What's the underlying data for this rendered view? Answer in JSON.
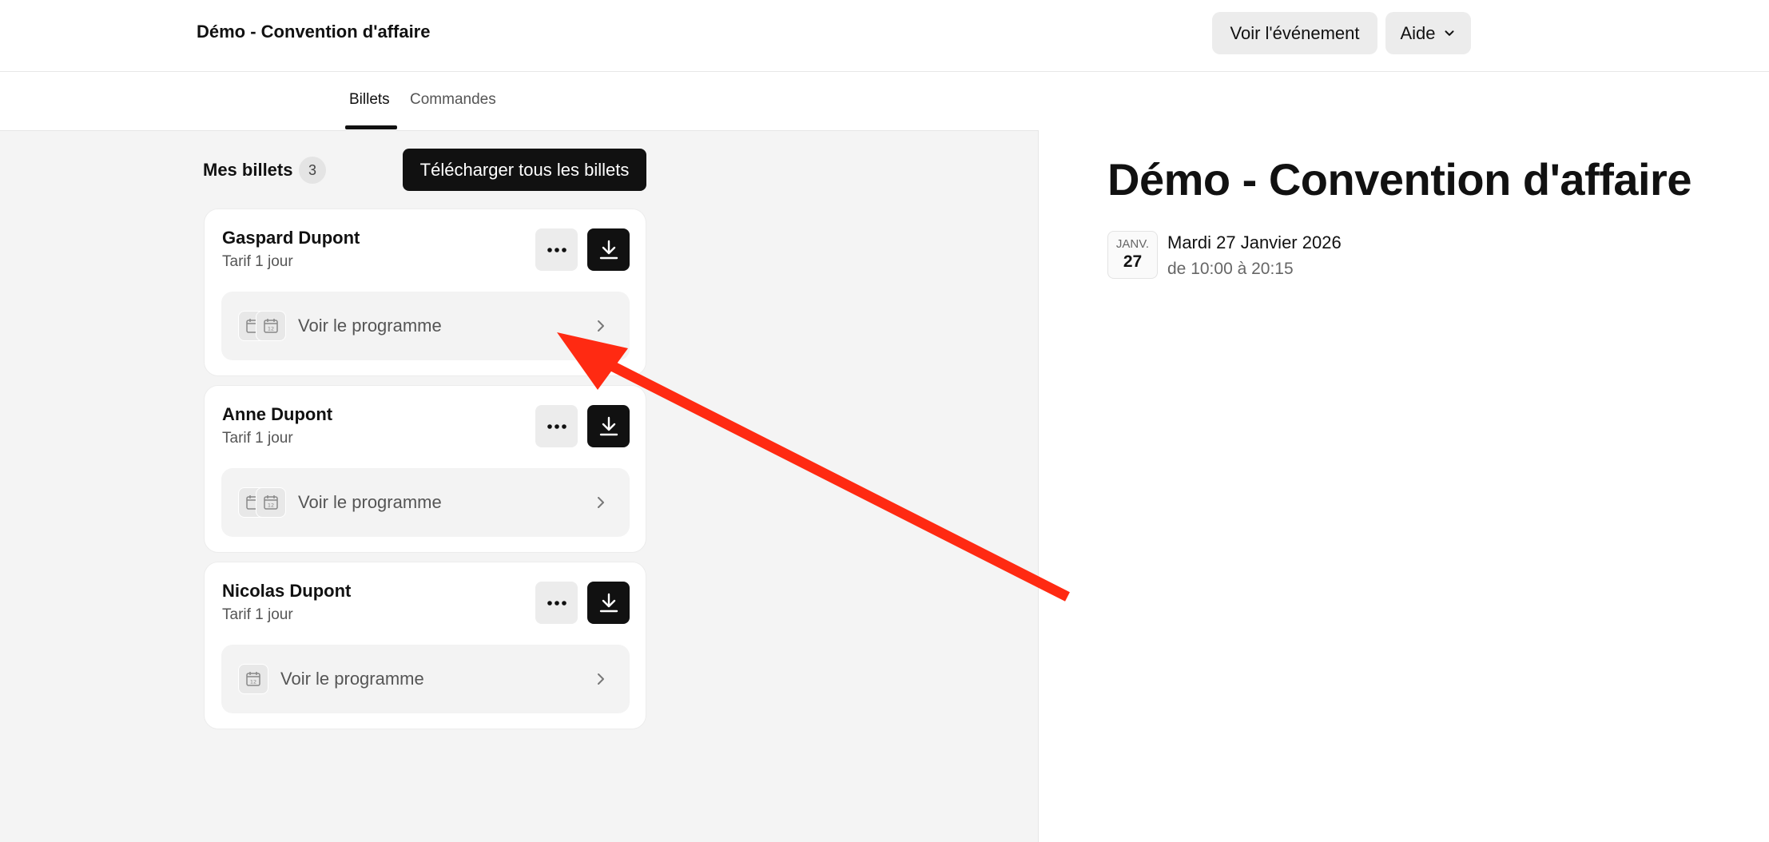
{
  "header": {
    "app_title": "Démo - Convention d'affaire",
    "view_event_label": "Voir l'événement",
    "help_label": "Aide"
  },
  "tabs": [
    {
      "label": "Billets",
      "active": true
    },
    {
      "label": "Commandes",
      "active": false
    }
  ],
  "tickets_section": {
    "title": "Mes billets",
    "count": "3",
    "download_all_label": "Télécharger tous les billets"
  },
  "tickets": [
    {
      "name": "Gaspard Dupont",
      "tier": "Tarif 1 jour",
      "program_label": "Voir le programme"
    },
    {
      "name": "Anne Dupont",
      "tier": "Tarif 1 jour",
      "program_label": "Voir le programme"
    },
    {
      "name": "Nicolas Dupont",
      "tier": "Tarif 1 jour",
      "program_label": "Voir le programme"
    }
  ],
  "event": {
    "title": "Démo - Convention d'affaire",
    "month": "JANV.",
    "day": "27",
    "date_text": "Mardi 27 Janvier 2026",
    "time_text": "de 10:00 à 20:15"
  },
  "icons": {
    "more": "more-horizontal-icon",
    "download": "download-icon",
    "calendar": "calendar-icon",
    "chevron_right": "chevron-right-icon",
    "chevron_down": "chevron-down-icon"
  },
  "colors": {
    "primary_button": "#111111",
    "annotation_arrow": "#ff2a12",
    "left_background": "#f4f4f4"
  }
}
